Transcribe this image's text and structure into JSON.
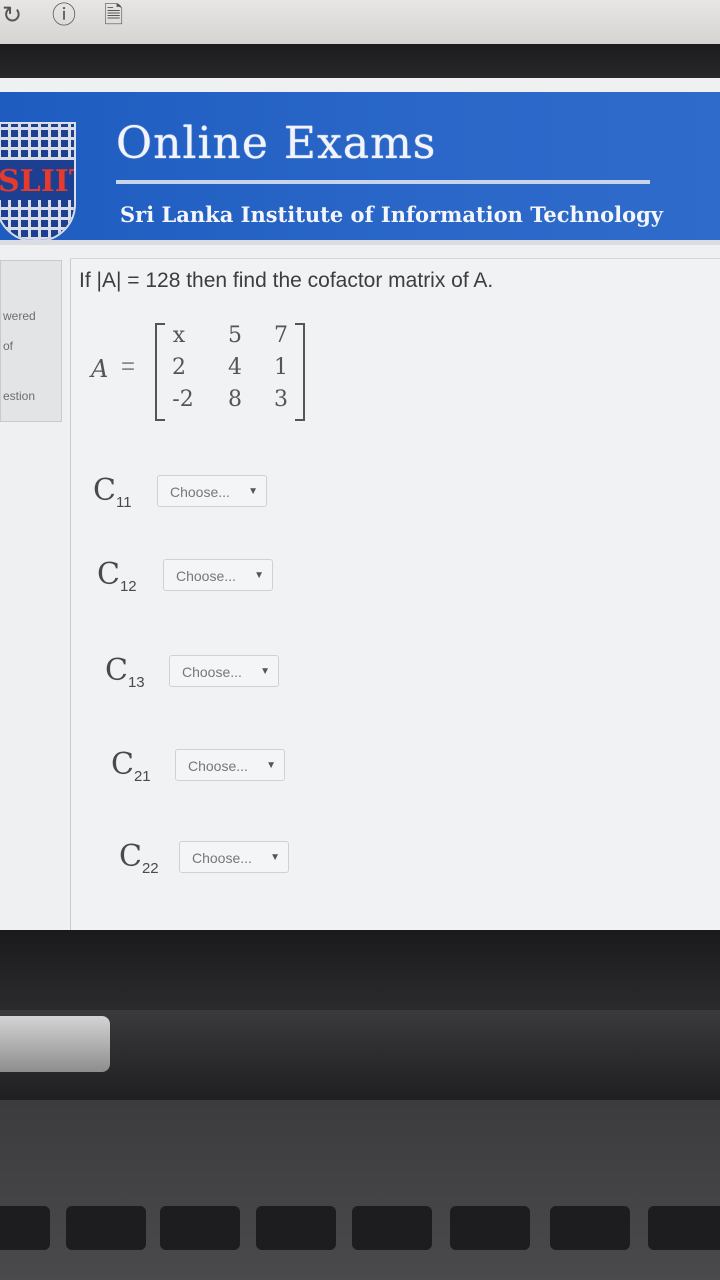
{
  "browser": {
    "icons": [
      "reload-icon",
      "info-icon",
      "document-icon"
    ]
  },
  "header": {
    "logo_text": "SLIIT",
    "title": "Online Exams",
    "subtitle": "Sri Lanka Institute of Information Technology"
  },
  "nav": {
    "line1": "wered",
    "line2": "of",
    "line3": "estion"
  },
  "question": {
    "text": "If |A| = 128 then find the cofactor matrix of A.",
    "matrix_name": "A",
    "matrix_eq": "=",
    "matrix": [
      [
        "x",
        "5",
        "7"
      ],
      [
        "2",
        "4",
        "1"
      ],
      [
        "-2",
        "8",
        "3"
      ]
    ]
  },
  "answers": [
    {
      "label": "C",
      "sub": "11",
      "placeholder": "Choose..."
    },
    {
      "label": "C",
      "sub": "12",
      "placeholder": "Choose..."
    },
    {
      "label": "C",
      "sub": "13",
      "placeholder": "Choose..."
    },
    {
      "label": "C",
      "sub": "21",
      "placeholder": "Choose..."
    },
    {
      "label": "C",
      "sub": "22",
      "placeholder": "Choose..."
    }
  ]
}
